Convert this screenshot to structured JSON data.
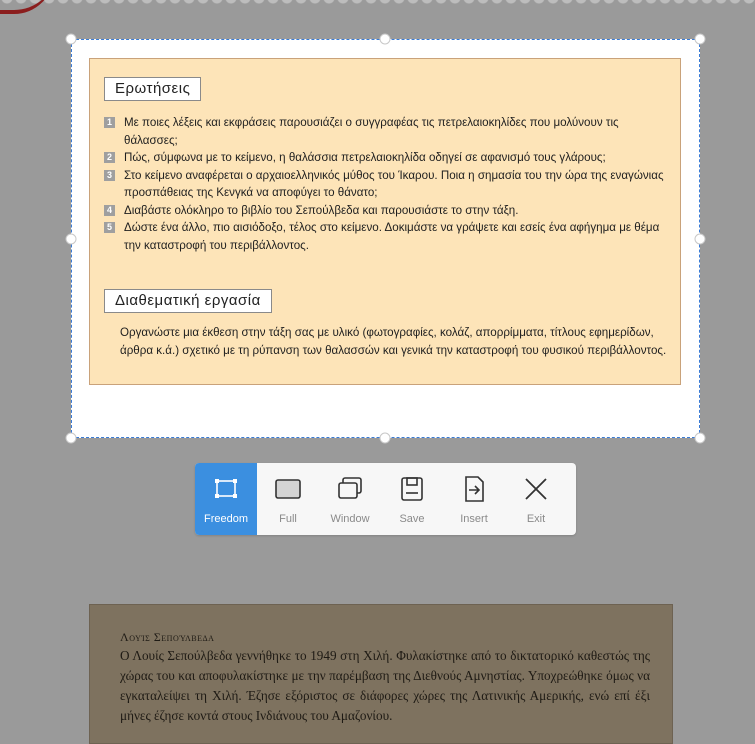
{
  "capture": {
    "questions_heading": "Ερωτήσεις",
    "questions": [
      {
        "num": "1",
        "text": "Με ποιες λέξεις και εκφράσεις παρουσιάζει ο συγγραφέας τις πετρελαιοκηλίδες που μολύνουν τις θάλασσες;"
      },
      {
        "num": "2",
        "text": "Πώς, σύμφωνα με το κείμενο, η θαλάσσια πετρελαιοκηλίδα οδηγεί σε αφανισμό τους γλάρους;"
      },
      {
        "num": "3",
        "text": "Στο κείμενο αναφέρεται ο αρχαιοελληνικός μύθος του Ίκαρου. Ποια η σημασία του την ώρα της εναγώνιας προσπάθειας της Κενγκά να αποφύγει το θάνατο;"
      },
      {
        "num": "4",
        "text": "Διαβάστε ολόκληρο το βιβλίο του Σεπούλβεδα και παρουσιάστε το στην τάξη."
      },
      {
        "num": "5",
        "text": "Δώστε ένα άλλο, πιο αισιόδοξο, τέλος στο κείμενο. Δοκιμάστε να γράψετε και εσείς ένα αφήγημα με θέμα την καταστροφή του περιβάλλοντος."
      }
    ],
    "project_heading": "Διαθεματική εργασία",
    "project_text": "Οργανώστε μια έκθεση στην τάξη σας με υλικό (φωτογραφίες, κολάζ, απορρίμματα, τίτλους εφημερίδων, άρθρα κ.ά.) σχετικό με τη ρύπανση των θαλασσών και γενικά την καταστροφή του φυσικού περιβάλλοντος."
  },
  "toolbar": {
    "buttons": [
      {
        "label": "Freedom",
        "icon": "freedom-select-icon",
        "active": true
      },
      {
        "label": "Full",
        "icon": "full-screen-icon",
        "active": false
      },
      {
        "label": "Window",
        "icon": "window-icon",
        "active": false
      },
      {
        "label": "Save",
        "icon": "save-icon",
        "active": false
      },
      {
        "label": "Insert",
        "icon": "insert-icon",
        "active": false
      },
      {
        "label": "Exit",
        "icon": "close-icon",
        "active": false
      }
    ],
    "accent_color": "#3b8fe0"
  },
  "page_below": {
    "author": "Λουίς Σεπούλβεδα",
    "text": "Ο Λουίς Σεπούλβεδα γεννήθηκε το 1949 στη Χιλή. Φυλακίστηκε από το δικτατορικό καθεστώς της χώρας του και αποφυλακίστηκε με την παρέμβαση της Διεθνούς Αμνηστίας. Υποχρεώθηκε όμως να εγκαταλείψει τη Χιλή. Έζησε εξόριστος σε διάφορες χώρες της Λατινικής Αμερικής, ενώ επί έξι μήνες έζησε κοντά στους Ινδιάνους του Αμαζονίου."
  }
}
